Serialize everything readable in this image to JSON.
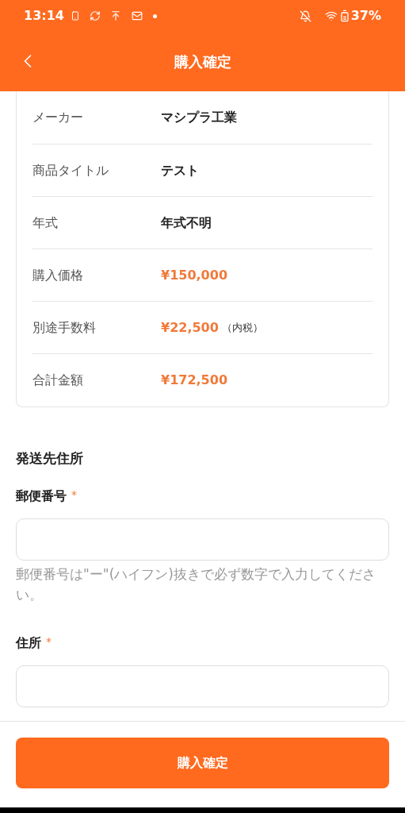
{
  "status_bar": {
    "time": "13:14",
    "battery": "37%"
  },
  "header": {
    "title": "購入確定"
  },
  "details": [
    {
      "label": "メーカー",
      "value": "マシプラ工業",
      "kind": "plain"
    },
    {
      "label": "商品タイトル",
      "value": "テスト",
      "kind": "plain"
    },
    {
      "label": "年式",
      "value": "年式不明",
      "kind": "plain"
    },
    {
      "label": "購入価格",
      "value": "¥150,000",
      "kind": "price"
    },
    {
      "label": "別途手数料",
      "value": "¥22,500",
      "note": "（内税）",
      "kind": "price"
    },
    {
      "label": "合計金額",
      "value": "¥172,500",
      "kind": "price"
    }
  ],
  "shipping": {
    "title": "発送先住所",
    "fields": [
      {
        "label": "郵便番号",
        "required_mark": "*",
        "hint": "郵便番号は\"ー\"(ハイフン)抜きで必ず数字で入力してください。"
      },
      {
        "label": "住所",
        "required_mark": "*"
      }
    ]
  },
  "confirm_button": "購入確定"
}
